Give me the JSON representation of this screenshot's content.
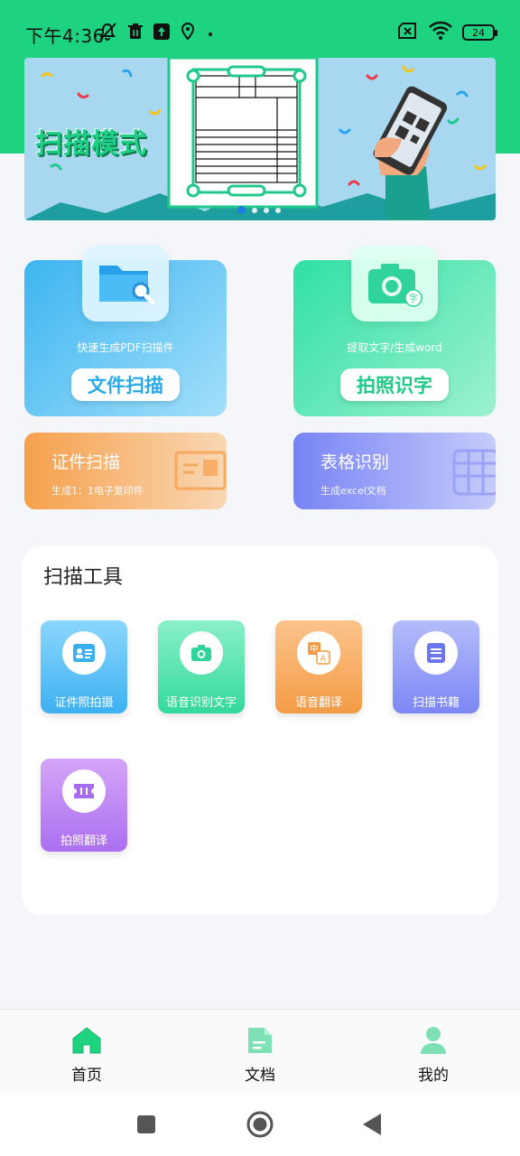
{
  "status_bar": {
    "time": "下午4:36",
    "battery": "24",
    "icons_left": [
      "mute-icon",
      "trash-icon",
      "upload-icon",
      "location-icon",
      "dot-icon"
    ],
    "icons_right": [
      "no-sim-icon",
      "wifi-icon",
      "battery-icon"
    ]
  },
  "banner": {
    "title": "扫描模式",
    "slide_count": 4,
    "active_slide": 1
  },
  "features": {
    "file_scan": {
      "subtitle": "快速生成PDF扫描件",
      "button": "文件扫描",
      "icon": "folder-search-icon"
    },
    "photo_ocr": {
      "subtitle": "提取文字/生成word",
      "button": "拍照识字",
      "icon": "camera-text-icon"
    },
    "id_scan": {
      "title": "证件扫描",
      "subtitle": "生成1：1电子复印件",
      "icon": "id-card-icon"
    },
    "table_ocr": {
      "title": "表格识别",
      "subtitle": "生成excel文档",
      "icon": "table-grid-icon"
    }
  },
  "tools": {
    "title": "扫描工具",
    "items": [
      {
        "label": "证件照拍摄",
        "icon": "id-photo-icon"
      },
      {
        "label": "语音识别文字",
        "icon": "camera-icon"
      },
      {
        "label": "语音翻译",
        "icon": "translate-icon"
      },
      {
        "label": "扫描书籍",
        "icon": "book-icon"
      },
      {
        "label": "拍照翻译",
        "icon": "ticket-icon"
      }
    ]
  },
  "bottom_nav": {
    "items": [
      {
        "label": "首页",
        "icon": "home-icon",
        "active": true
      },
      {
        "label": "文档",
        "icon": "document-icon",
        "active": false
      },
      {
        "label": "我的",
        "icon": "user-icon",
        "active": false
      }
    ]
  },
  "colors": {
    "brand_green": "#1dd37f",
    "blue_card": "#3cb5f0",
    "green_card": "#2fe0a4",
    "orange_card": "#f6a04c",
    "purple_card": "#7884f6"
  }
}
